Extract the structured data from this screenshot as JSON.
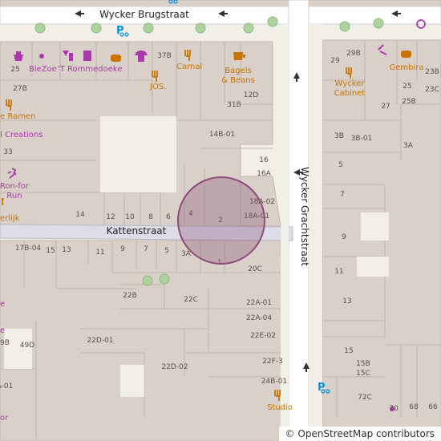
{
  "streets": {
    "wycker_brugstraat": "Wycker Brugstraat",
    "kattenstraat": "Kattenstraat",
    "wycker_grachtstraat": "Wycker Grachtstraat"
  },
  "pois": {
    "biezoe": "BieZoe",
    "rommedoeke": "'T Rommedoeke",
    "jos": "JOS.",
    "carnal": "Carnal",
    "bagels": "Bagels",
    "bagels2": "& Beans",
    "ramen": "e Ramen",
    "creations": "l Creations",
    "ronfor": "Ron-for",
    "run": "Run",
    "erlijk": "erlijk",
    "wycker": "Wycker",
    "cabinet": "Cabinet",
    "gembira": "Gembira",
    "studio": "Studio",
    "e_left1": "e",
    "e_left2": "e",
    "or_left": "or"
  },
  "house_numbers": {
    "n25": "25",
    "n37b": "37B",
    "n27b": "27B",
    "n33": "33",
    "n12d": "12D",
    "n31b": "31B",
    "n14b01": "14B-01",
    "n16": "16",
    "n16a": "16A",
    "n18a02": "18A-02",
    "n18a01": "18A-01",
    "n14": "14",
    "n12": "12",
    "n10": "10",
    "n8": "8",
    "n6": "6",
    "n4": "4",
    "n2": "2",
    "n17b04": "17B-04",
    "n15": "15",
    "n13": "13",
    "n11": "11",
    "n9": "9",
    "n7": "7",
    "n5": "5",
    "n3a": "3A",
    "n1": "1",
    "n20c": "20C",
    "n22b": "22B",
    "n22c": "22C",
    "n22a01": "22A-01",
    "n22a04": "22A-04",
    "n22e02": "22E-02",
    "n22d01": "22D-01",
    "n49d": "49D",
    "n9b": "9B",
    "n22d02": "22D-02",
    "n22f3": "22F-3",
    "n24b01": "24B-01",
    "na01": "A-01",
    "n29": "29",
    "n29b": "29B",
    "r25": "25",
    "r23b": "23B",
    "r25b": "25B",
    "r23c": "23C",
    "r27": "27",
    "r3b": "3B",
    "r3b01": "3B-01",
    "r3a": "3A",
    "r5": "5",
    "r7": "7",
    "r9": "9",
    "r11": "11",
    "r13": "13",
    "r15": "15",
    "r15b": "15B",
    "r15c": "15C",
    "r72c": "72C",
    "r70": "70",
    "r68": "68",
    "r66": "66"
  },
  "attribution": {
    "symbol": "©",
    "text": "OpenStreetMap contributors"
  },
  "colors": {
    "background": "#f2efe9",
    "building": "#d9d0c9",
    "building_stroke": "#c4b6ab",
    "pedestrian_street": "#dddde8",
    "road": "#ffffff",
    "poi_shop": "#ac39ac",
    "poi_food": "#c77400",
    "tree": "#aed1a0",
    "highlight_fill": "rgba(130,70,110,0.30)",
    "highlight_stroke": "#8e4a7a"
  }
}
